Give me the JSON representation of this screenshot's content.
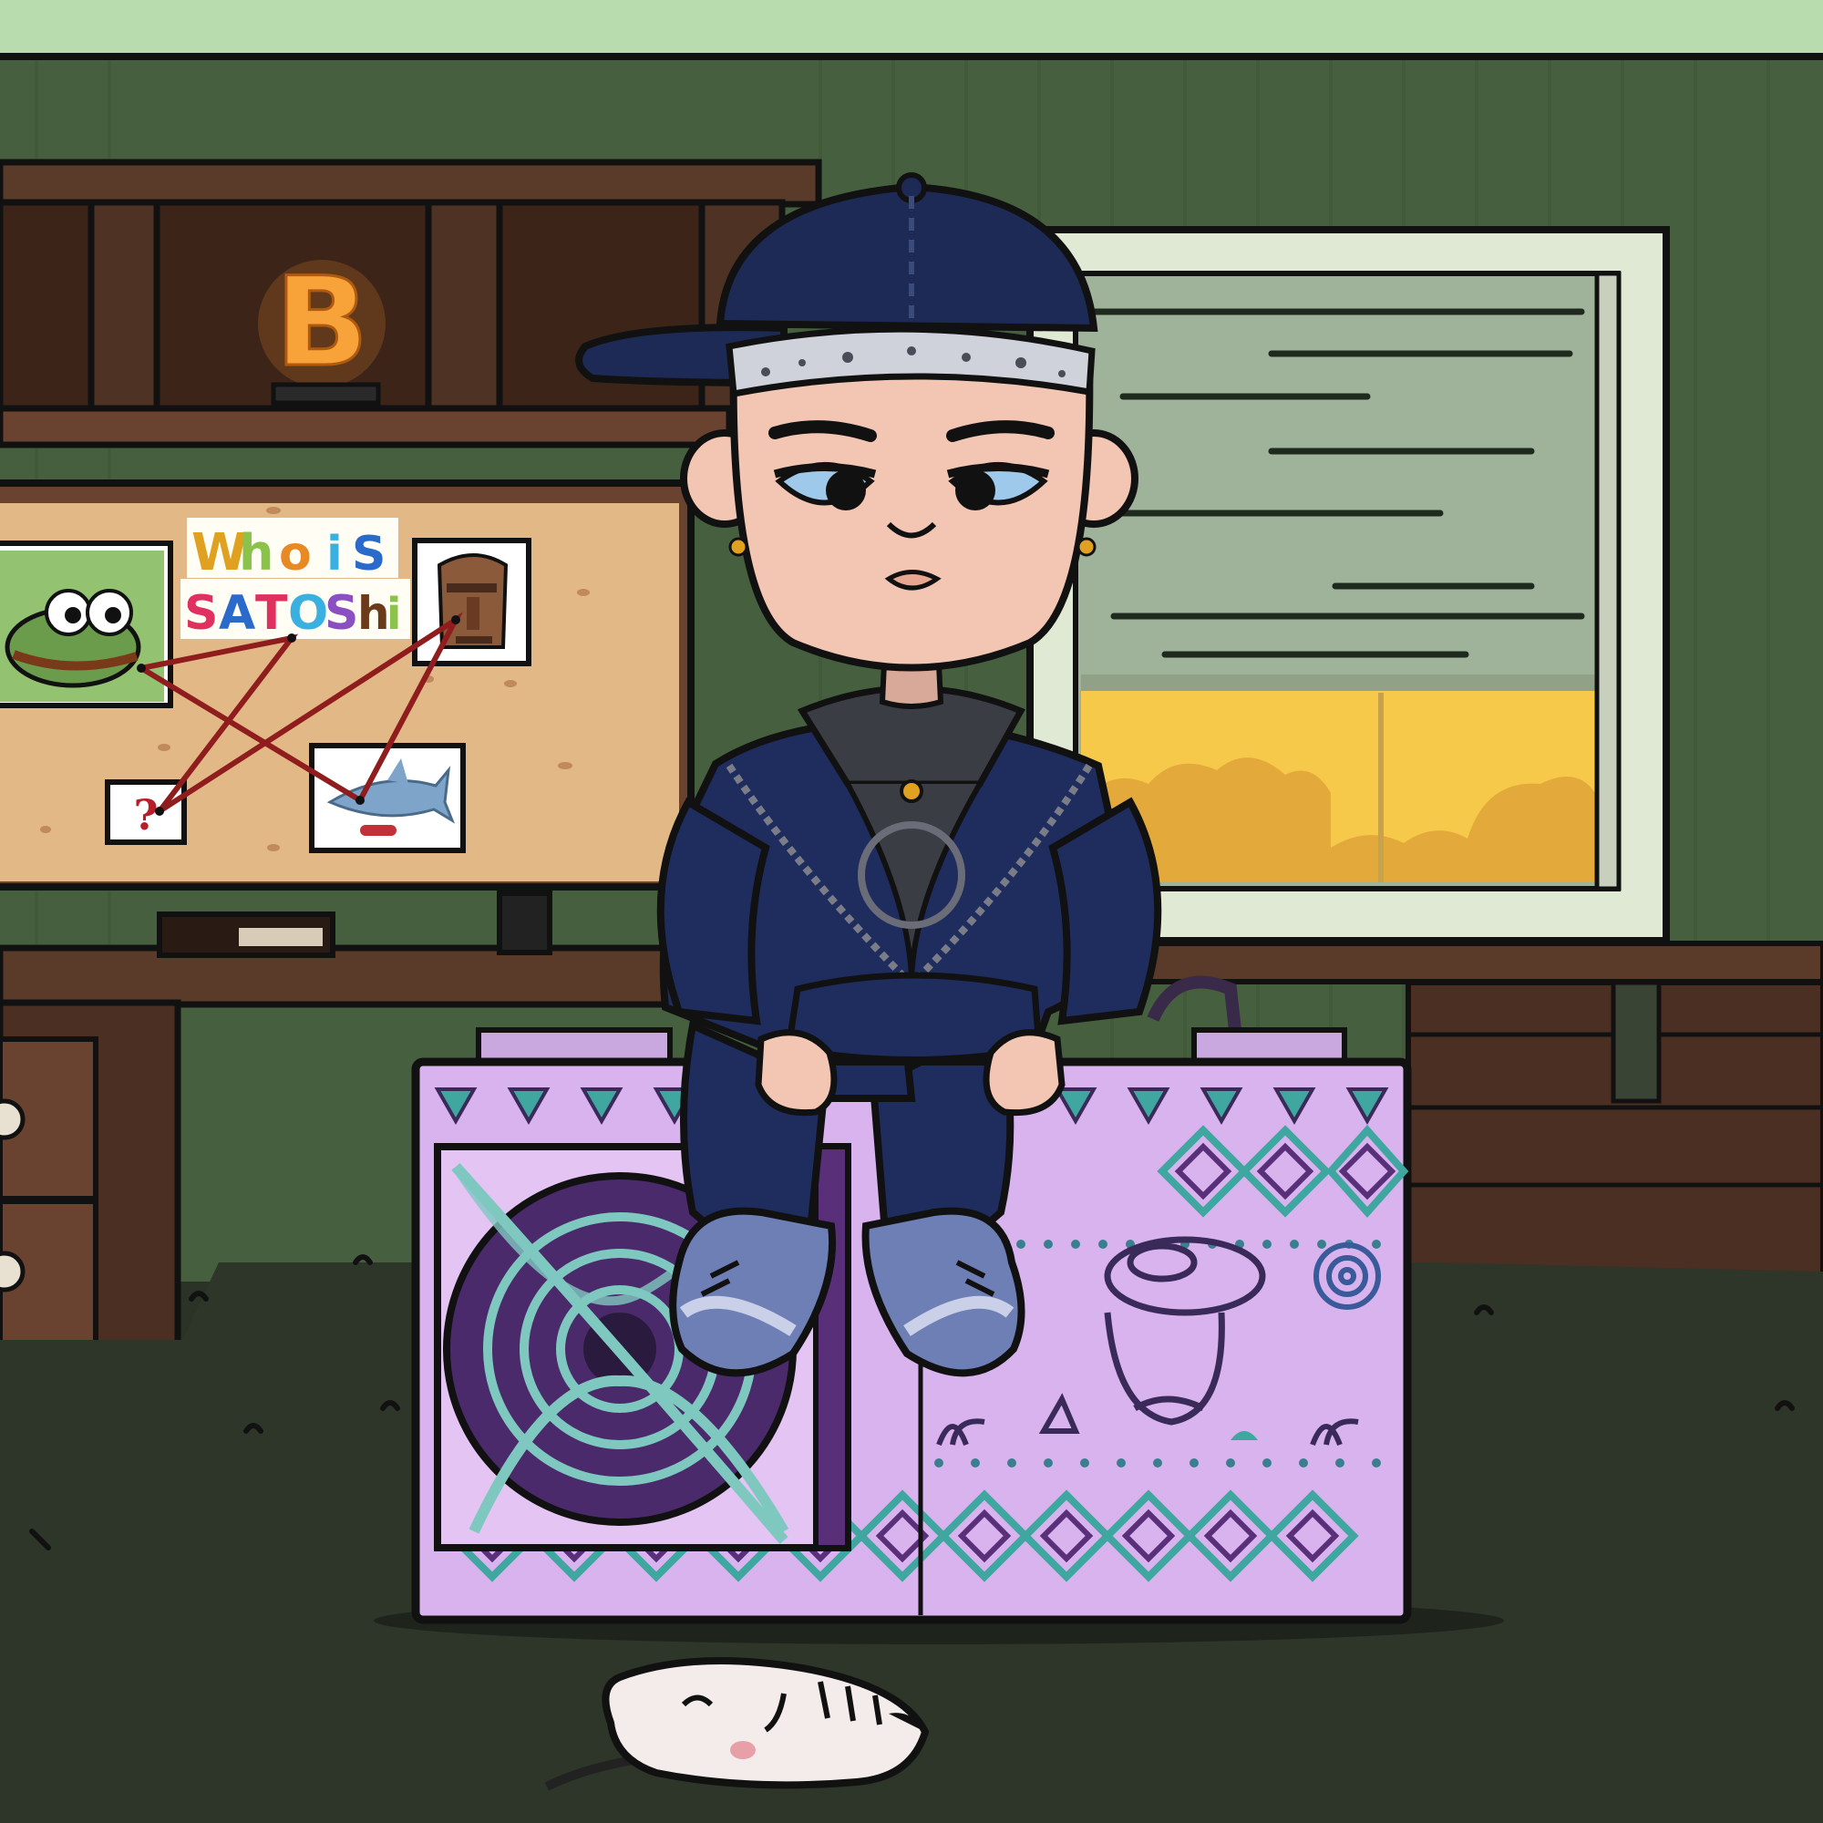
{
  "scene": {
    "title": "",
    "description_hidden": true
  },
  "corkboard": {
    "headline_words": [
      "Who",
      "is",
      "SATOSHi"
    ],
    "headline_letters_line1": [
      "W",
      "h",
      "o",
      "i",
      "S"
    ],
    "headline_letters_line2": [
      "S",
      "A",
      "T",
      "O",
      "S",
      "h",
      "i"
    ],
    "question_note": "?"
  },
  "shelf": {
    "neon_sign": "B"
  },
  "colors": {
    "sky": "#b9dcae",
    "wall": "#46603f",
    "wood_dark": "#4a2f22",
    "wood_mid": "#6a4330",
    "cork": "#e3b887",
    "floor": "#2e3529",
    "cap": "#1d2a56",
    "jacket": "#1f2c5e",
    "hoodie": "#3b3d45",
    "skin": "#f3c6b4",
    "miner_purple": "#d8b3ee",
    "miner_teal": "#3fa7a0",
    "window_sunset": "#f7c94a",
    "neon_orange": "#ff9c2a"
  },
  "icons": [
    "bitcoin-neon-icon",
    "pepe-frog-icon",
    "moai-icon",
    "shark-icon",
    "question-mark-icon",
    "fan-grille-icon",
    "sugar-skull-icon",
    "rose-icon",
    "mask-icon"
  ]
}
